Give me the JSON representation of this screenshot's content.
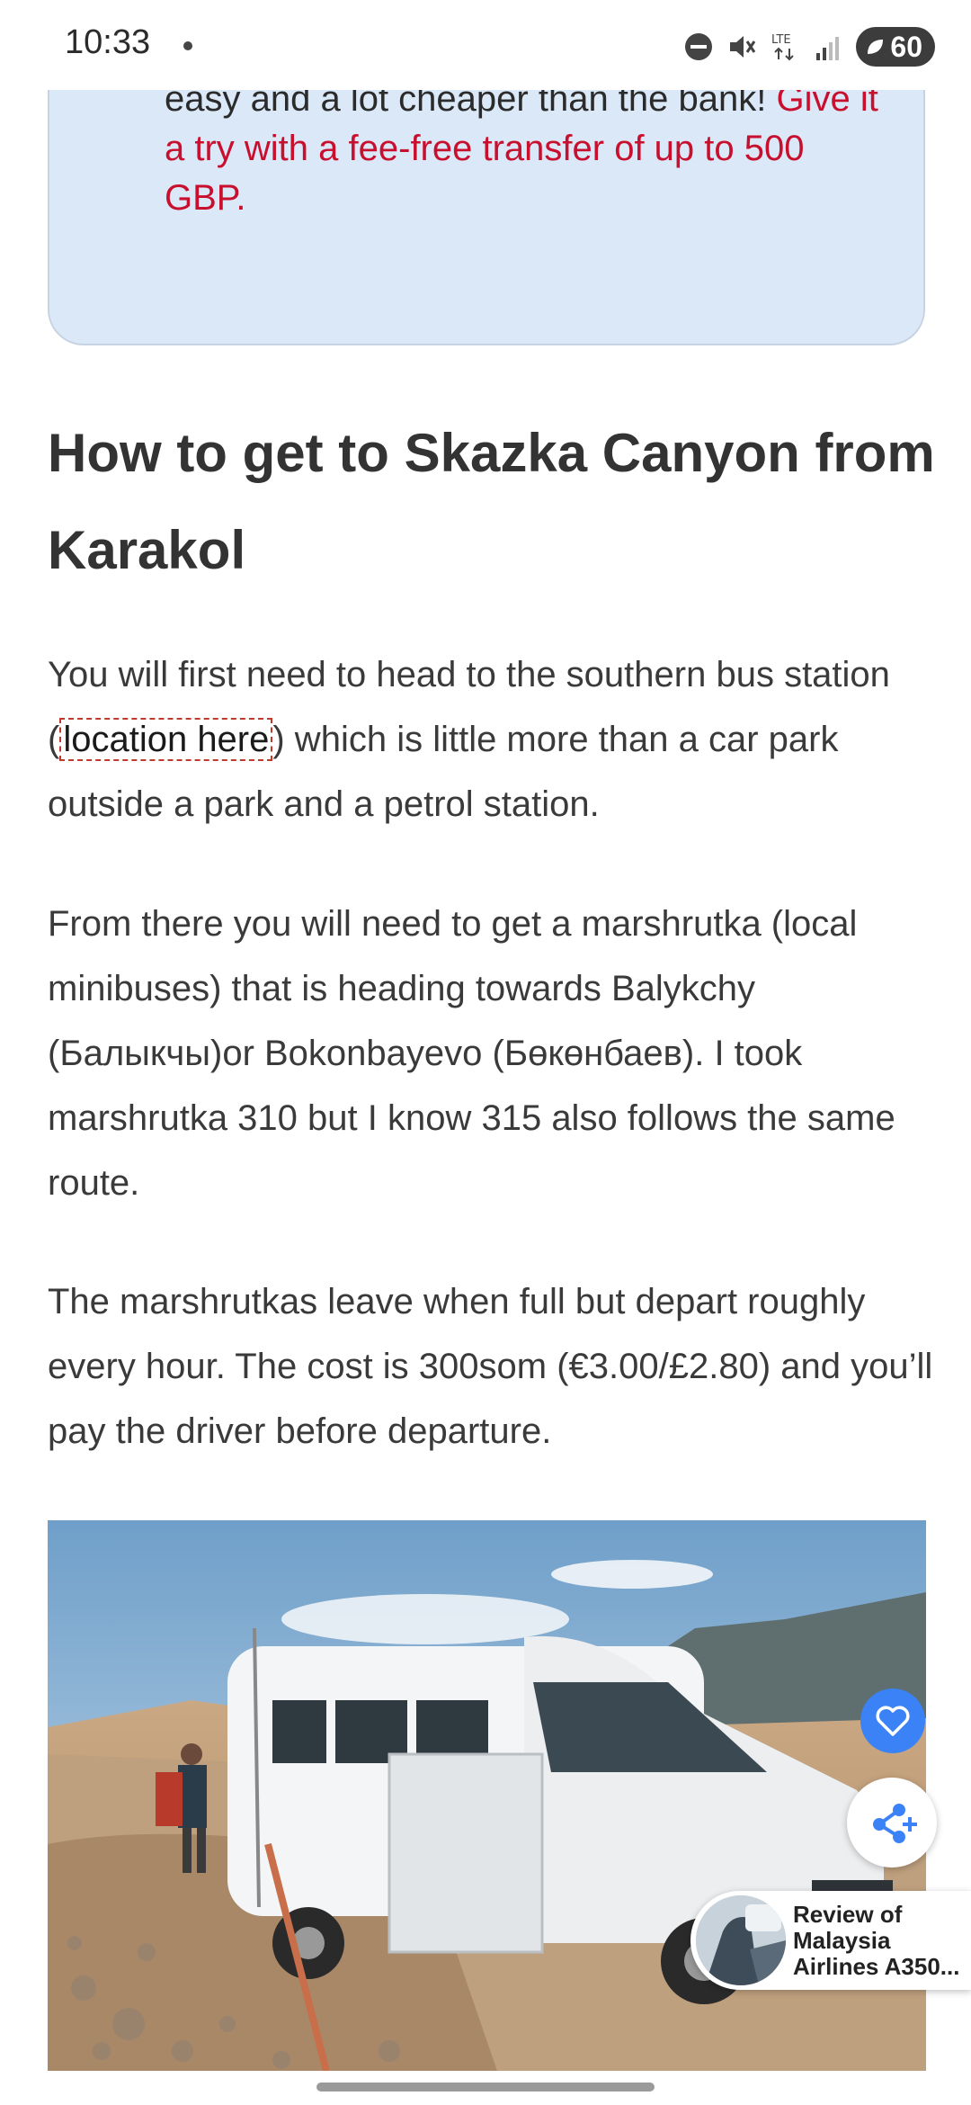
{
  "status_bar": {
    "time": "10:33",
    "battery": "60"
  },
  "tip": {
    "line_partial": "I use Wise to send money abroad. Really easy and a lot cheaper than the bank!",
    "offer": "Give it a try with a fee-free transfer of up to 500 GBP."
  },
  "article": {
    "heading": "How to get to Skazka Canyon from Karakol",
    "p1_before": "You will first need to head to the southern bus station (",
    "p1_link": "location here",
    "p1_after": ") which is little more than a car park outside a park and a petrol station.",
    "p2": "From there you will need to get a marshrutka (local minibuses) that is heading towards Balykchy (Балыкчы)or Bokonbayevo (Бөкөнбаев). I took marshrutka 310 but I know 315 also follows the same route.",
    "p3": "The marshrutkas leave when full but depart roughly every hour. The cost is 300som (€3.00/£2.80) and you’ll pay the driver before departure."
  },
  "promo": {
    "title": "Review of Malaysia Airlines A350..."
  },
  "colors": {
    "accent_red": "#c8102e",
    "tip_bg": "#dbe8f7",
    "fab_blue": "#3b82f6"
  }
}
